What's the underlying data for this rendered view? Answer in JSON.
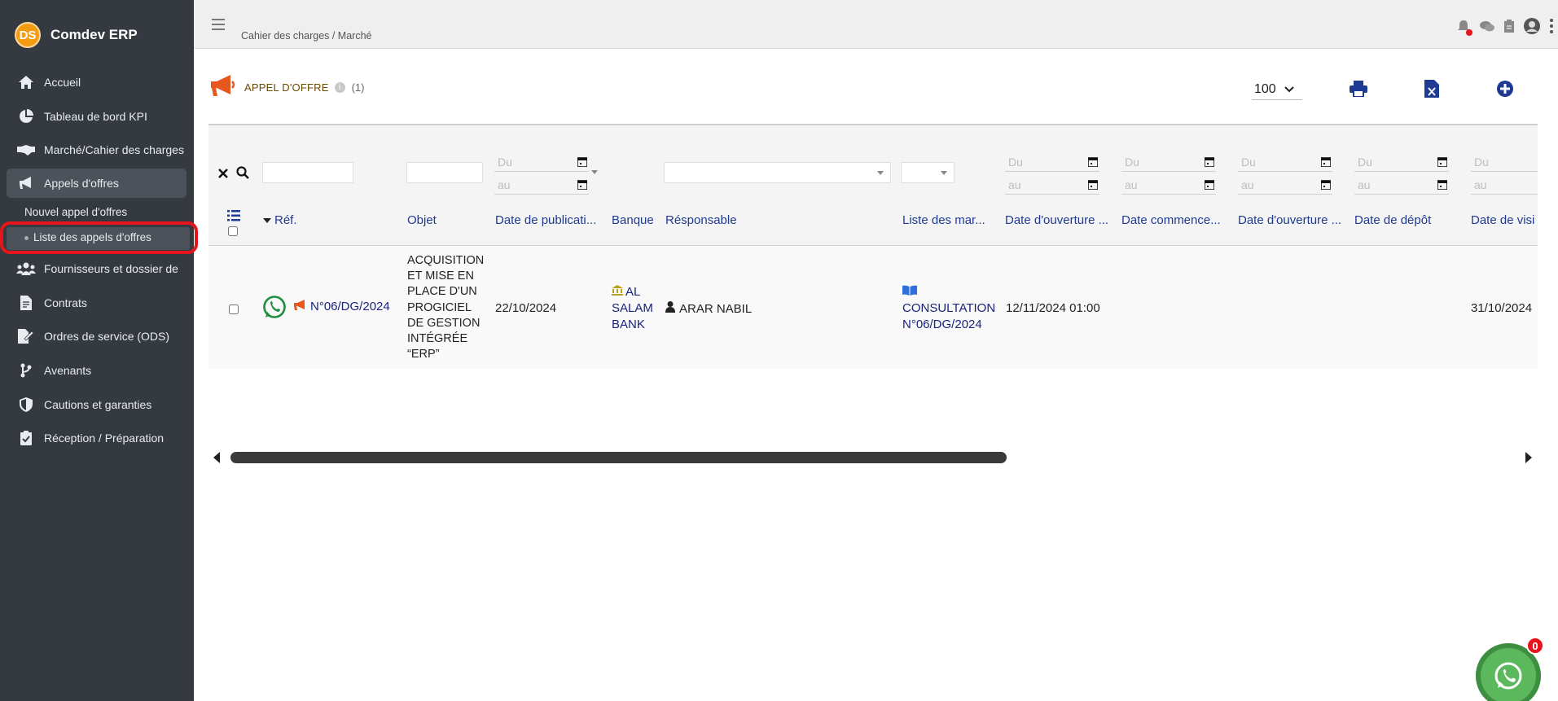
{
  "app": {
    "name": "Comdev ERP",
    "logo_text": "DS"
  },
  "sidebar": {
    "items": [
      {
        "label": "Accueil",
        "icon": "home-icon"
      },
      {
        "label": "Tableau de bord KPI",
        "icon": "pie-chart-icon"
      },
      {
        "label": "Marché/Cahier des charges",
        "icon": "handshake-icon"
      },
      {
        "label": "Appels d'offres",
        "icon": "megaphone-icon"
      },
      {
        "label": "Fournisseurs et dossier de",
        "icon": "users-icon"
      },
      {
        "label": "Contrats",
        "icon": "file-contract-icon"
      },
      {
        "label": "Ordres de service (ODS)",
        "icon": "file-signature-icon"
      },
      {
        "label": "Avenants",
        "icon": "code-branch-icon"
      },
      {
        "label": "Cautions et garanties",
        "icon": "shield-icon"
      },
      {
        "label": "Réception / Préparation",
        "icon": "clipboard-check-icon"
      }
    ],
    "sub_items": [
      {
        "label": "Nouvel appel d'offres"
      },
      {
        "label": "Liste des appels d'offres"
      }
    ]
  },
  "header": {
    "breadcrumb": "Cahier des charges / Marché"
  },
  "page": {
    "title": "APPEL D'OFFRE",
    "count": "(1)",
    "page_size": "100"
  },
  "filters": {
    "date_from": "Du",
    "date_to": "au"
  },
  "table": {
    "columns": [
      "Réf.",
      "Objet",
      "Date de publicati...",
      "Banque",
      "Résponsable",
      "Liste des mar...",
      "Date d'ouverture ...",
      "Date commence...",
      "Date d'ouverture ...",
      "Date de dépôt",
      "Date de visi"
    ],
    "rows": [
      {
        "ref": "N°06/DG/2024",
        "objet": [
          "ACQUISITION",
          "ET MISE EN",
          "PLACE D'UN",
          "PROGICIEL",
          "DE GESTION",
          "INTÉGRÉE",
          "“ERP”"
        ],
        "date_publication": "22/10/2024",
        "banque": [
          "AL",
          "SALAM",
          "BANK"
        ],
        "responsable": "ARAR NABIL",
        "liste_marches": [
          "CONSULTATION",
          "N°06/DG/2024"
        ],
        "date_ouverture": "12/11/2024 01:00",
        "date_visite": "31/10/2024"
      }
    ]
  },
  "chat": {
    "badge": "0"
  },
  "colors": {
    "sidebar_bg": "#343a40",
    "accent_orange": "#e8571c",
    "link_blue": "#1a237e",
    "whatsapp_green": "#1e8e3e"
  }
}
